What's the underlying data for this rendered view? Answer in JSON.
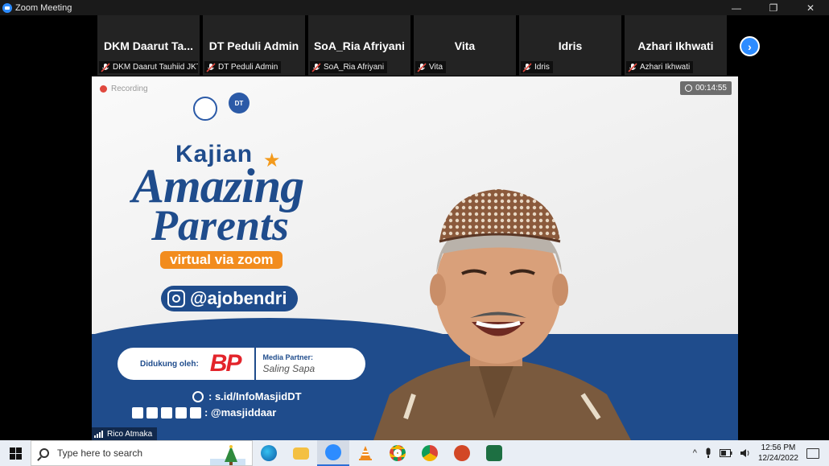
{
  "window": {
    "title": "Zoom Meeting",
    "minimize": "—",
    "restore": "❐",
    "close": "✕"
  },
  "gallery": {
    "tiles": [
      {
        "name": "DKM  Daarut  Ta...",
        "label": "DKM Daarut Tauhiid JKT"
      },
      {
        "name": "DT Peduli Admin",
        "label": "DT Peduli Admin"
      },
      {
        "name": "SoA_Ria Afriyani",
        "label": "SoA_Ria Afriyani"
      },
      {
        "name": "Vita",
        "label": "Vita"
      },
      {
        "name": "Idris",
        "label": "Idris"
      },
      {
        "name": "Azhari Ikhwati",
        "label": "Azhari Ikhwati"
      }
    ],
    "next_arrow": "›"
  },
  "main": {
    "recording": "Recording",
    "timer": "00:14:55",
    "logo_text": "DT",
    "slide": {
      "kajian": "Kajian",
      "star": "★",
      "amazing": "Amazing",
      "parents": "Parents",
      "virtual": "virtual via zoom",
      "handle": "@ajobendri",
      "supported_by": "Didukung oleh:",
      "bp": "BP",
      "media_partner": "Media Partner:",
      "saling": "Saling Sapa",
      "link": ": s.id/InfoMasjidDT",
      "social": ": @masjiddaar"
    },
    "speaker_name": "Rico Atmaka"
  },
  "taskbar": {
    "search_placeholder": "Type here to search",
    "time": "12:56 PM",
    "date": "12/24/2022",
    "tray_caret": "^"
  },
  "colors": {
    "zoom_blue": "#2d8cff",
    "slide_blue": "#1f4c8c",
    "slide_orange": "#f28c1e",
    "bp_red": "#e3242b"
  }
}
